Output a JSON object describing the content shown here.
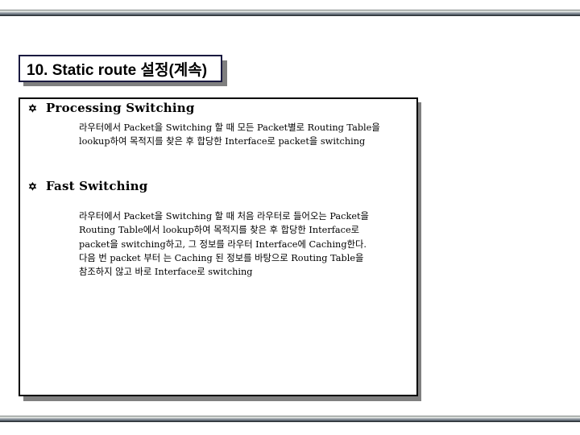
{
  "slide": {
    "title": "10. Static route 설정(계속)",
    "sections": [
      {
        "bullet_icon": "star-of-david-icon",
        "bullet_glyph": "✡",
        "heading": "Processing Switching",
        "lines": [
          "라우터에서 Packet을 Switching 할 때 모든 Packet별로 Routing Table을",
          "lookup하여 목적지를 찾은 후 합당한 Interface로 packet을 switching"
        ]
      },
      {
        "bullet_icon": "star-of-david-icon",
        "bullet_glyph": "✡",
        "heading": "Fast Switching",
        "lines": [
          "라우터에서 Packet을 Switching 할 때 처음 라우터로 들어오는 Packet을",
          "Routing Table에서 lookup하여 목적지를 찾은 후 합당한 Interface로",
          "packet을 switching하고, 그 정보를 라우터 Interface에 Caching한다.",
          "다음 번 packet 부터 는 Caching 된 정보를 바탕으로 Routing Table을",
          "참조하지 않고 바로 Interface로 switching"
        ]
      }
    ]
  }
}
